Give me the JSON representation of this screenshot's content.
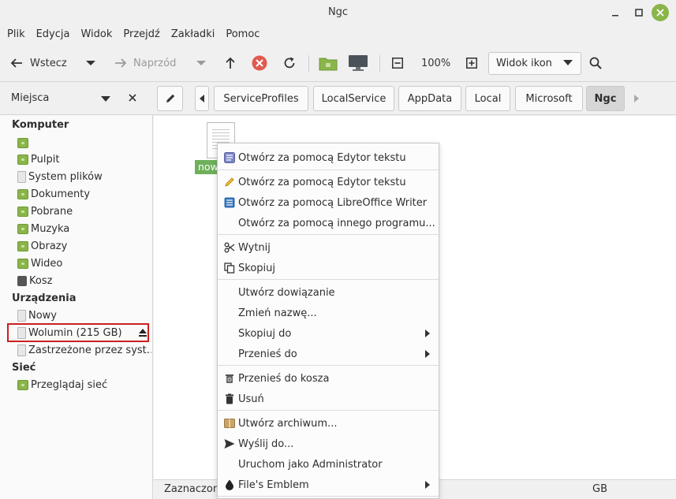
{
  "window": {
    "title": "Ngc"
  },
  "menubar": [
    "Plik",
    "Edycja",
    "Widok",
    "Przejdź",
    "Zakładki",
    "Pomoc"
  ],
  "toolbar": {
    "back_label": "Wstecz",
    "forward_label": "Naprzód",
    "zoom": "100%",
    "view_mode": "Widok ikon"
  },
  "sidebar": {
    "title": "Miejsca",
    "sections": {
      "computer": "Komputer",
      "devices": "Urządzenia",
      "network": "Sieć"
    },
    "computer_items": [
      "",
      "Pulpit",
      "System plików",
      "Dokumenty",
      "Pobrane",
      "Muzyka",
      "Obrazy",
      "Wideo",
      "Kosz"
    ],
    "device_items": [
      "Nowy",
      "Wolumin (215 GB)",
      "Zastrzeżone przez syst…"
    ],
    "network_items": [
      "Przeglądaj sieć"
    ]
  },
  "pathbar": [
    "ServiceProfiles",
    "LocalService",
    "AppData",
    "Local",
    "Microsoft",
    "Ngc"
  ],
  "content": {
    "file_label": "now"
  },
  "status": {
    "left": "Zaznaczon",
    "right": "GB"
  },
  "context_menu": {
    "items": [
      "Otwórz za pomocą Edytor tekstu",
      "Otwórz za pomocą Edytor tekstu",
      "Otwórz za pomocą LibreOffice Writer",
      "Otwórz za pomocą innego programu...",
      "Wytnij",
      "Skopiuj",
      "Utwórz dowiązanie",
      "Zmień nazwę...",
      "Skopiuj do",
      "Przenieś do",
      "Przenieś do kosza",
      "Usuń",
      "Utwórz archiwum...",
      "Wyślij do...",
      "Uruchom jako Administrator",
      "File's Emblem"
    ]
  },
  "colors": {
    "accent": "#8ab54a",
    "file_label_bg": "#6fb05b",
    "highlight": "#cc1f1f",
    "stop_red": "#e05a4f"
  }
}
